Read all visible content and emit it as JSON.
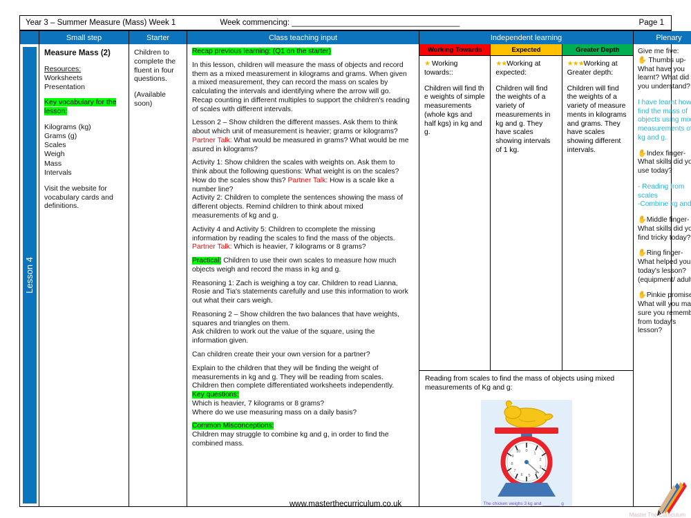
{
  "header": {
    "title": "Year 3 – Summer Measure (Mass)  Week 1",
    "week_commencing": "Week commencing: ______________________________________",
    "page": "Page 1"
  },
  "columns": {
    "spine_label": "Lesson 4",
    "small_step": "Small step",
    "starter": "Starter",
    "class_input": "Class teaching input",
    "independent": "Independent learning",
    "plenary": "Plenary"
  },
  "small_step": {
    "title": "Measure Mass (2)",
    "resources_label": "Resources:",
    "resources": [
      "Worksheets",
      "Presentation"
    ],
    "vocab_heading_line1": "Key vocabulary for the",
    "vocab_heading_line2": "lesson:",
    "vocab": [
      "Kilograms (kg)",
      "Grams (g)",
      "Scales",
      "Weigh",
      "Mass",
      "Intervals"
    ],
    "footer_note": "Visit the website for vocabulary cards and definitions."
  },
  "starter": {
    "text": "Children to complete the fluent in four questions.",
    "availability": "(Available soon)"
  },
  "class_input": {
    "recap_heading": "Recap previous learning: (Q1 on the starter)",
    "para1": "In this lesson, children will measure the mass of objects and record them as a mixed measurement in kilograms and grams. When given a mixed measurement, they can record the mass on scales by calculating the intervals and identifying where the arrow will go. Recap counting in different multiples to support the children's reading of scales with different intervals.",
    "lesson2": "Lesson 2 – Show children the different masses. Ask them to think about which unit of measurement is heavier; grams or kilograms?",
    "partner_talk_label": "Partner Talk:",
    "lesson2_pt": " What would be measured in grams? What would be me asured in kilograms?",
    "activity1": "Activity 1: Show children the scales with weights on. Ask them to think about the following questions: What weight is on the scales? How do the scales show this? ",
    "activity1_pt": " How is a scale like a number line?",
    "activity2": "Activity 2:  Children to complete the sentences showing the mass of different objects. Remind children to think about mixed measurements of kg and g.",
    "activity45": "Activity 4 and Activity 5: Children to ccomplete the missing information by reading the scales to find the mass of the objects.",
    "activity45_pt": " Which is heavier, 7 kilograms or 8 grams?",
    "practical_label": "Practical:",
    "practical": " Children to use their own scales to measure how much objects weigh and record the mass in kg and g.",
    "reasoning1": "Reasoning 1: Zach is weighing a toy car. Children to read Lianna, Rosie and Tia's statements carefully and use this information to work out what their cars weigh.",
    "reasoning2": "Reasoning 2 – Show children the two balances that have weights, squares and triangles on them.",
    "reasoning2b": "Ask children to work out the value of the square, using the information given.",
    "reasoning2c": "Can children create their your own version for a partner?",
    "explain": "Explain to the children that they will be finding the weight of measurements in kg and g. They will be reading from scales.",
    "explain2": "Children then complete differentiated worksheets independently.",
    "key_questions_heading": "Key questions:",
    "key_questions": [
      "Which is heavier, 7 kilograms or 8 grams?",
      "Where do we use measuring mass on a daily basis?"
    ],
    "misconceptions_heading": "Common Misconceptions:",
    "misconceptions": "Children may struggle to combine kg and g, in order to find the combined mass."
  },
  "independent": {
    "groups": [
      {
        "label": "Working Towards",
        "color": "#ff0000",
        "stars": "★",
        "sub_heading": " Working towards::",
        "body": "Children will find th e weights of simple measurements (whole kgs and half kgs) in kg and g."
      },
      {
        "label": "Expected",
        "color": "#ffc000",
        "stars": "★★",
        "sub_heading": "Working at expected:",
        "body": "Children will find the weights of a variety of measurements in kg and g. They have scales showing intervals of 1 kg."
      },
      {
        "label": "Greater Depth",
        "color": "#00b050",
        "stars": "★★★",
        "sub_heading": "Working at Greater depth:",
        "body": "Children will find the weights of a variety of measure ments in kilograms and grams. They have scales showing different intervals."
      }
    ],
    "bottom_caption": "Reading from scales to find the mass of objects using mixed measurements of Kg and g:",
    "figure_caption": "The chicken weighs 3 kg and _______ g",
    "dial_numbers": [
      "0",
      "1",
      "2",
      "3",
      "4",
      "5",
      "6",
      "7",
      "8",
      "9",
      "10"
    ]
  },
  "plenary": {
    "heading": "Give me five:",
    "items": [
      {
        "icon": "✋",
        "text": " Thumbs up- What have you learnt? What did you understand?"
      },
      {
        "answer": "I have learnt how to find the mass of objects using mixed measurements of kg and g."
      },
      {
        "icon": "✋",
        "text": "Index finger- What skills did you use today?"
      },
      {
        "answer": "- Reading from scales\n-Combine kg and g"
      },
      {
        "icon": "✋",
        "text": "Middle finger- What skills did you find tricky today?"
      },
      {
        "icon": "✋",
        "text": "Ring finger- What helped you in today's lesson? (equipment/ adult)"
      },
      {
        "icon": "✋",
        "text": "Pinkie promise- What will you make sure you remember from today's lesson?"
      }
    ]
  },
  "footer": {
    "watermark": "www.masterthecurriculum.co.uk",
    "brand": "Master The Curriculum"
  },
  "colors": {
    "brand_blue": "#0c73bd",
    "highlight_green": "#00ff00",
    "partner_red": "#ff0000",
    "answer_teal": "#29b3d9",
    "working_towards": "#ff0000",
    "expected": "#ffc000",
    "greater_depth": "#00b050"
  }
}
